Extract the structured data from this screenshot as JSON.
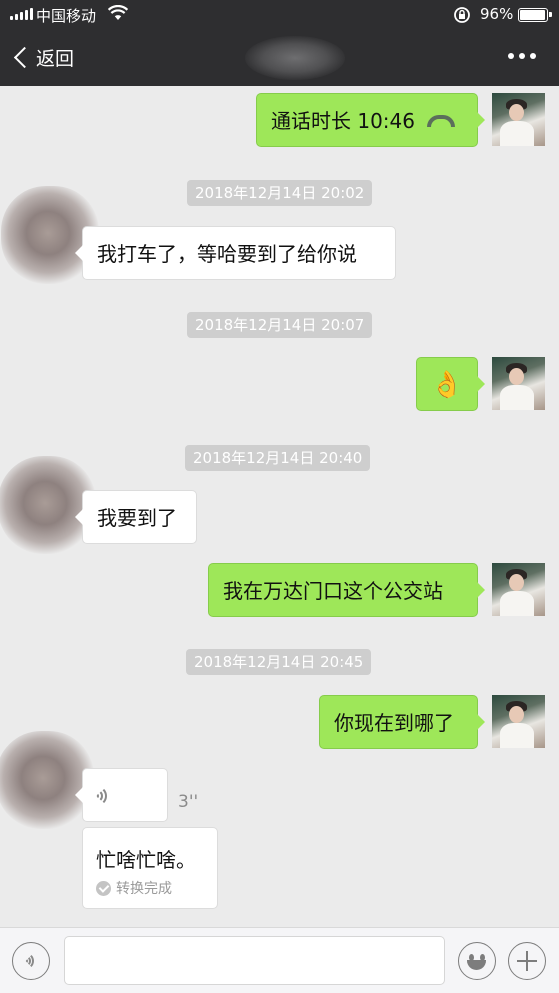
{
  "status_bar": {
    "carrier": "中国移动",
    "battery_percent": "96%",
    "battery_level": 0.96
  },
  "nav": {
    "back_label": "返回",
    "more_icon": "more-icon"
  },
  "messages": [
    {
      "type": "call",
      "side": "self",
      "text": "通话时长 10:46",
      "icon": "phone-hangup-icon"
    },
    {
      "type": "time",
      "text": "2018年12月14日 20:02"
    },
    {
      "type": "text",
      "side": "other",
      "text": "我打车了，等哈要到了给你说"
    },
    {
      "type": "time",
      "text": "2018年12月14日 20:07"
    },
    {
      "type": "emoji",
      "side": "self",
      "text": "👌"
    },
    {
      "type": "time",
      "text": "2018年12月14日 20:40"
    },
    {
      "type": "text",
      "side": "other",
      "text": "我要到了"
    },
    {
      "type": "text",
      "side": "self",
      "text": "我在万达门口这个公交站"
    },
    {
      "type": "time",
      "text": "2018年12月14日 20:45"
    },
    {
      "type": "text",
      "side": "self",
      "text": "你现在到哪了"
    },
    {
      "type": "voice",
      "side": "other",
      "duration": "3''",
      "transcription": "忙啥忙啥。",
      "transcription_status": "转换完成"
    }
  ],
  "input_bar": {
    "voice_icon": "voice-icon",
    "emoji_icon": "emoji-icon",
    "plus_icon": "plus-icon"
  }
}
